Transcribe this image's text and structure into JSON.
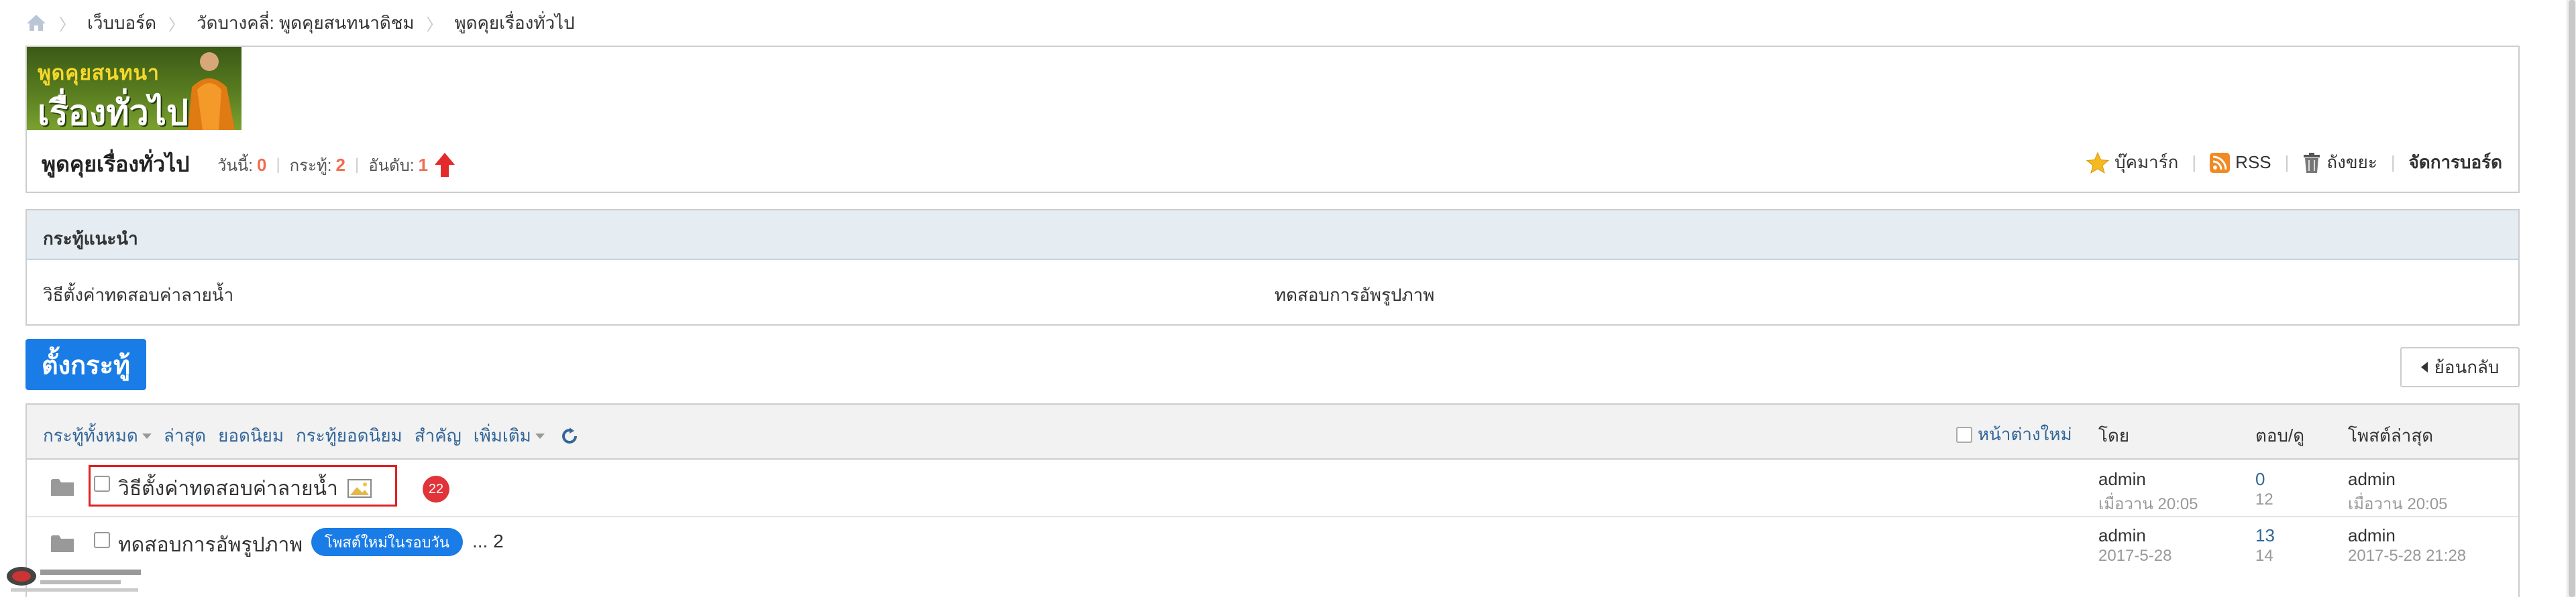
{
  "breadcrumb": {
    "items": [
      "เว็บบอร์ด",
      "วัดบางคลี่: พูดคุยสนทนาดิชม",
      "พูดคุยเรื่องทั่วไป"
    ],
    "separator": "〉"
  },
  "banner": {
    "line1": "พูดคุยสนทนา",
    "line2": "เรื่องทั่วไป"
  },
  "forum": {
    "name": "พูดคุยเรื่องทั่วไป",
    "today_label": "วันนี้:",
    "today": "0",
    "threads_label": "กระทู้:",
    "threads": "2",
    "rank_label": "อันดับ:",
    "rank": "1"
  },
  "tools": {
    "bookmark": "บุ๊คมาร์ก",
    "rss": "RSS",
    "trash": "ถังขยะ",
    "manage": "จัดการบอร์ด"
  },
  "recommended": {
    "heading": "กระทู้แนะนำ",
    "items": [
      "วิธีตั้งค่าทดสอบค่าลายน้ำ",
      "ทดสอบการอัพรูปภาพ"
    ]
  },
  "buttons": {
    "new_thread": "ตั้งกระทู้",
    "back": "ย้อนกลับ"
  },
  "filters": {
    "all": "กระทู้ทั้งหมด",
    "latest": "ล่าสุด",
    "popular": "ยอดนิยม",
    "hot": "กระทู้ยอดนิยม",
    "important": "สำคัญ",
    "more": "เพิ่มเติม",
    "new_window": "หน้าต่างใหม่"
  },
  "columns": {
    "by": "โดย",
    "replies_views": "ตอบ/ดู",
    "last_post": "โพสต์ล่าสุด"
  },
  "threads": [
    {
      "title": "วิธีตั้งค่าทดสอบค่าลายน้ำ",
      "badge": "22",
      "author": "admin",
      "date": "เมื่อวาน 20:05",
      "replies": "0",
      "views": "12",
      "last_author": "admin",
      "last_date": "เมื่อวาน 20:05"
    },
    {
      "title": "ทดสอบการอัพรูปภาพ",
      "tag": "โพสต์ใหม่ในรอบวัน",
      "pages": "... 2",
      "author": "admin",
      "date": "2017-5-28",
      "replies": "13",
      "views": "14",
      "last_author": "admin",
      "last_date": "2017-5-28 21:28"
    }
  ],
  "colors": {
    "accent": "#1a7ce6",
    "link": "#336699",
    "highlight": "#f26c4f",
    "badge": "#e0333a"
  }
}
